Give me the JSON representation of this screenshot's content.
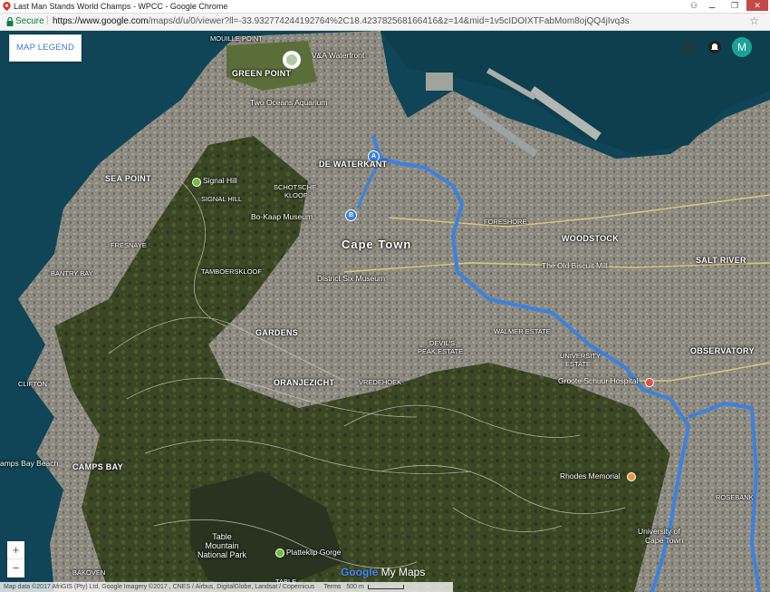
{
  "window": {
    "title": "Last Man Stands World Champs - WPCC - Google Chrome",
    "controls": [
      "⚊",
      "❐",
      "✕"
    ]
  },
  "address_bar": {
    "secure_label": "Secure",
    "url_host": "https://www.google.com",
    "url_path": "/maps/d/u/0/viewer?ll=-33.93277424419276​4%2C18.4237825681664​16&z=14&mid=1v5cIDOIXTFabMom8ojQQ4jIvq3s"
  },
  "map_ui": {
    "legend_button": "MAP LEGEND",
    "avatar_letter": "M",
    "zoom_in": "+",
    "zoom_out": "−",
    "brand_google": "Google",
    "brand_mymaps": " My Maps",
    "footer_attribution": "Map data ©2017 AfriGIS (Pty) Ltd, Google Imagery ©2017 , CNES / Airbus, DigitalGlobe, Landsat / Copernicus",
    "footer_terms": "Terms",
    "footer_scale": "500 m"
  },
  "labels": {
    "mouille_point": "MOUILLE POINT",
    "green_point": "GREEN POINT",
    "va_waterfront": "V&A Waterfront",
    "two_oceans": "Two Oceans Aquarium",
    "de_waterkant": "DE WATERKANT",
    "sea_point": "SEA POINT",
    "signal_hill_poi": "Signal Hill",
    "signal_hill": "SIGNAL HILL",
    "schotsche_kloof_1": "SCHOTSCHE",
    "schotsche_kloof_2": "KLOOF",
    "bokaap": "Bo-Kaap Museum",
    "foreshore": "FORESHORE",
    "woodstock": "WOODSTOCK",
    "cape_town": "Cape Town",
    "fresnaye": "FRESNAYE",
    "old_biscuit": "The Old Biscuit Mill",
    "salt_river": "SALT RIVER",
    "bantry_bay": "BANTRY BAY",
    "tamboerskloof": "TAMBOERSKLOOF",
    "district_six": "District Six Museum",
    "gardens": "GARDENS",
    "walmer": "WALMER ESTATE",
    "devils_peak_1": "DEVIL'S",
    "devils_peak_2": "PEAK ESTATE",
    "observatory": "OBSERVATORY",
    "university_1": "UNIVERSITY",
    "university_2": "ESTATE",
    "clifton": "CLIFTON",
    "oranjezicht": "ORANJEZICHT",
    "vredehoek": "VREDEHOEK",
    "groote_schuur": "Groote Schuur Hospital",
    "camps_bay_beach": "amps Bay Beach",
    "camps_bay": "CAMPS BAY",
    "rhodes": "Rhodes Memorial",
    "rosebank": "ROSEBANK",
    "table_mountain_1": "Table",
    "table_mountain_2": "Mountain",
    "table_mountain_3": "National Park",
    "platteklip": "Platteklip Gorge",
    "uct_1": "University of",
    "uct_2": "Cape Town",
    "bakoven": "BAKOVEN",
    "table_bottom": "TABLE"
  },
  "route_pins": [
    "A",
    "B"
  ],
  "colors": {
    "route": "#3b82e0",
    "ocean": "#0f4556",
    "mountain": "#33401f",
    "urban": "#8a8a82",
    "legend_text": "#3c7bd6",
    "avatar": "#1aa394"
  },
  "icons": [
    "lock-icon",
    "star-icon",
    "apps-grid-icon",
    "notifications-icon"
  ]
}
